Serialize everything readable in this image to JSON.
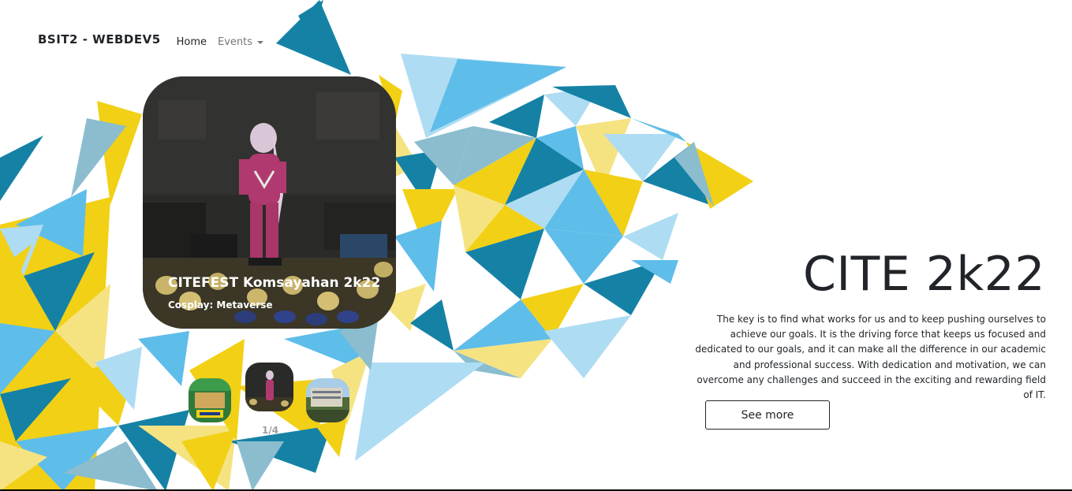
{
  "navbar": {
    "brand": "BSIT2 - WEBDEV5",
    "links": [
      {
        "label": "Home"
      },
      {
        "label": "Events",
        "dropdown": true
      }
    ]
  },
  "carousel": {
    "active_slide": {
      "title": "CITEFEST Komsayahan 2k22",
      "subtitle": "Cosplay: Metaverse"
    },
    "counter": "1/4",
    "thumbnail_icons": [
      "champions-photo",
      "cosplay-photo",
      "campus-building-photo"
    ]
  },
  "hero": {
    "title": "CITE 2k22",
    "description": "The key is to find what works for us and to keep pushing ourselves to achieve our goals. It is the driving force that keeps us focused and dedicated to our goals, and it can make all the difference in our academic and professional success. With dedication and motivation, we can overcome any challenges and succeed in the exciting and rewarding field of IT.",
    "button_label": "See more"
  },
  "colors": {
    "yellow": "#f2d015",
    "light_yellow": "#f5e382",
    "dark_blue": "#1582a5",
    "sky_blue": "#5fbde9",
    "light_blue": "#aedcf3",
    "pale_blue": "#8bbdcf"
  }
}
